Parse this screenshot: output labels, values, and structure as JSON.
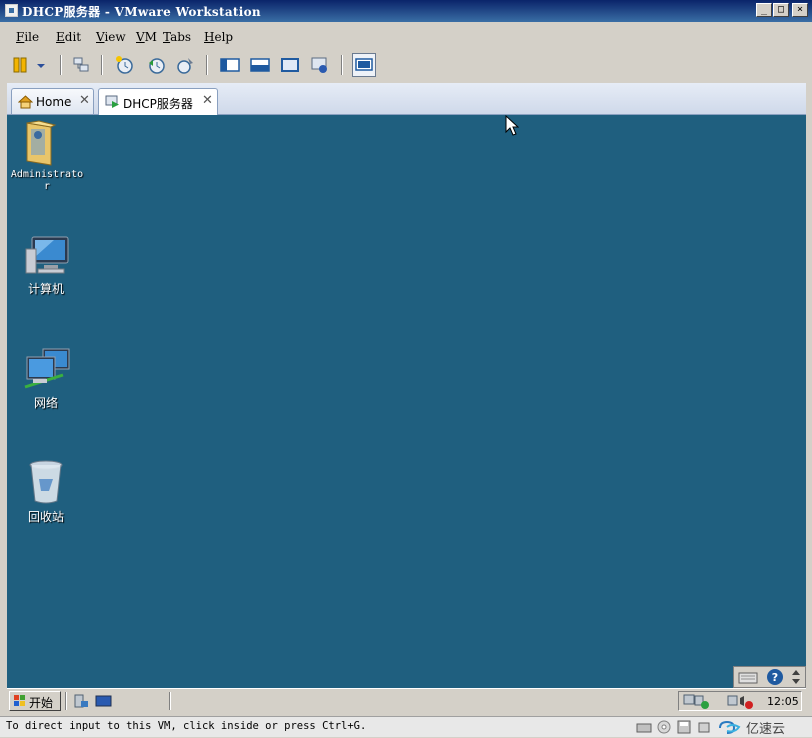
{
  "window": {
    "title": "DHCP服务器 - VMware Workstation"
  },
  "menu": [
    "File",
    "Edit",
    "View",
    "VM",
    "Tabs",
    "Help"
  ],
  "tabs": [
    {
      "label": "Home",
      "icon": "home-icon"
    },
    {
      "label": "DHCP服务器",
      "icon": "vm-play-icon",
      "active": true
    }
  ],
  "desktop": {
    "background": "#1f5f7f",
    "icons": [
      {
        "label": "Administrator",
        "icon": "user-folder-icon"
      },
      {
        "label": "计算机",
        "icon": "computer-icon"
      },
      {
        "label": "网络",
        "icon": "network-icon"
      },
      {
        "label": "回收站",
        "icon": "recycle-bin-icon"
      }
    ]
  },
  "taskbar": {
    "start_label": "开始",
    "clock": "12:05"
  },
  "statusbar": {
    "message": "To direct input to this VM, click inside or press Ctrl+G.",
    "watermark": "亿速云"
  }
}
